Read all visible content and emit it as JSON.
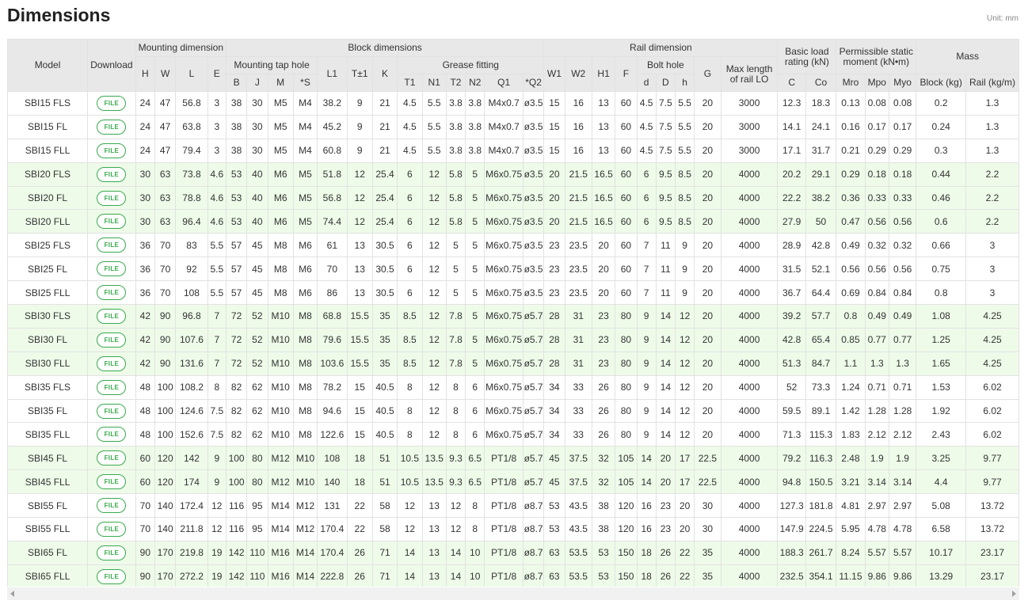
{
  "title": "Dimensions",
  "unit_note": "Unit: mm",
  "headers": {
    "model": "Model",
    "download": "Download",
    "mounting_dimension": "Mounting dimension",
    "block_dimensions": "Block dimensions",
    "rail_dimension": "Rail dimension",
    "basic_load_rating": "Basic load rating (kN)",
    "permissible_static_moment": "Permissible static moment (kN•m)",
    "mass": "Mass",
    "mounting_tap_hole": "Mounting tap hole",
    "grease_fitting": "Grease fitting",
    "bolt_hole": "Bolt hole",
    "max_length": "Max length of rail LO",
    "cols": {
      "H": "H",
      "W": "W",
      "L": "L",
      "E": "E",
      "B": "B",
      "J": "J",
      "M": "M",
      "S": "*S",
      "L1": "L1",
      "T": "T±1",
      "K": "K",
      "T1": "T1",
      "N1": "N1",
      "T2": "T2",
      "N2": "N2",
      "Q1": "Q1",
      "Q2": "*Q2",
      "W1": "W1",
      "W2": "W2",
      "H1": "H1",
      "F": "F",
      "d": "d",
      "D": "D",
      "h": "h",
      "G": "G",
      "C": "C",
      "Co": "Co",
      "Mro": "Mro",
      "Mpo": "Mpo",
      "Myo": "Myo",
      "block": "Block (kg)",
      "rail": "Rail (kg/m)"
    }
  },
  "file_label": "FILE",
  "rows": [
    [
      "SBI15 FLS",
      "24",
      "47",
      "56.8",
      "3",
      "38",
      "30",
      "M5",
      "M4",
      "38.2",
      "9",
      "21",
      "4.5",
      "5.5",
      "3.8",
      "3.8",
      "M4x0.7",
      "ø3.5",
      "15",
      "16",
      "13",
      "60",
      "4.5",
      "7.5",
      "5.5",
      "20",
      "3000",
      "12.3",
      "18.3",
      "0.13",
      "0.08",
      "0.08",
      "0.2",
      "1.3"
    ],
    [
      "SBI15 FL",
      "24",
      "47",
      "63.8",
      "3",
      "38",
      "30",
      "M5",
      "M4",
      "45.2",
      "9",
      "21",
      "4.5",
      "5.5",
      "3.8",
      "3.8",
      "M4x0.7",
      "ø3.5",
      "15",
      "16",
      "13",
      "60",
      "4.5",
      "7.5",
      "5.5",
      "20",
      "3000",
      "14.1",
      "24.1",
      "0.16",
      "0.17",
      "0.17",
      "0.24",
      "1.3"
    ],
    [
      "SBI15 FLL",
      "24",
      "47",
      "79.4",
      "3",
      "38",
      "30",
      "M5",
      "M4",
      "60.8",
      "9",
      "21",
      "4.5",
      "5.5",
      "3.8",
      "3.8",
      "M4x0.7",
      "ø3.5",
      "15",
      "16",
      "13",
      "60",
      "4.5",
      "7.5",
      "5.5",
      "20",
      "3000",
      "17.1",
      "31.7",
      "0.21",
      "0.29",
      "0.29",
      "0.3",
      "1.3"
    ],
    [
      "SBI20 FLS",
      "30",
      "63",
      "73.8",
      "4.6",
      "53",
      "40",
      "M6",
      "M5",
      "51.8",
      "12",
      "25.4",
      "6",
      "12",
      "5.8",
      "5",
      "M6x0.75",
      "ø3.5",
      "20",
      "21.5",
      "16.5",
      "60",
      "6",
      "9.5",
      "8.5",
      "20",
      "4000",
      "20.2",
      "29.1",
      "0.29",
      "0.18",
      "0.18",
      "0.44",
      "2.2"
    ],
    [
      "SBI20 FL",
      "30",
      "63",
      "78.8",
      "4.6",
      "53",
      "40",
      "M6",
      "M5",
      "56.8",
      "12",
      "25.4",
      "6",
      "12",
      "5.8",
      "5",
      "M6x0.75",
      "ø3.5",
      "20",
      "21.5",
      "16.5",
      "60",
      "6",
      "9.5",
      "8.5",
      "20",
      "4000",
      "22.2",
      "38.2",
      "0.36",
      "0.33",
      "0.33",
      "0.46",
      "2.2"
    ],
    [
      "SBI20 FLL",
      "30",
      "63",
      "96.4",
      "4.6",
      "53",
      "40",
      "M6",
      "M5",
      "74.4",
      "12",
      "25.4",
      "6",
      "12",
      "5.8",
      "5",
      "M6x0.75",
      "ø3.5",
      "20",
      "21.5",
      "16.5",
      "60",
      "6",
      "9.5",
      "8.5",
      "20",
      "4000",
      "27.9",
      "50",
      "0.47",
      "0.56",
      "0.56",
      "0.6",
      "2.2"
    ],
    [
      "SBI25 FLS",
      "36",
      "70",
      "83",
      "5.5",
      "57",
      "45",
      "M8",
      "M6",
      "61",
      "13",
      "30.5",
      "6",
      "12",
      "5",
      "5",
      "M6x0.75",
      "ø3.5",
      "23",
      "23.5",
      "20",
      "60",
      "7",
      "11",
      "9",
      "20",
      "4000",
      "28.9",
      "42.8",
      "0.49",
      "0.32",
      "0.32",
      "0.66",
      "3"
    ],
    [
      "SBI25 FL",
      "36",
      "70",
      "92",
      "5.5",
      "57",
      "45",
      "M8",
      "M6",
      "70",
      "13",
      "30.5",
      "6",
      "12",
      "5",
      "5",
      "M6x0.75",
      "ø3.5",
      "23",
      "23.5",
      "20",
      "60",
      "7",
      "11",
      "9",
      "20",
      "4000",
      "31.5",
      "52.1",
      "0.56",
      "0.56",
      "0.56",
      "0.75",
      "3"
    ],
    [
      "SBI25 FLL",
      "36",
      "70",
      "108",
      "5.5",
      "57",
      "45",
      "M8",
      "M6",
      "86",
      "13",
      "30.5",
      "6",
      "12",
      "5",
      "5",
      "M6x0.75",
      "ø3.5",
      "23",
      "23.5",
      "20",
      "60",
      "7",
      "11",
      "9",
      "20",
      "4000",
      "36.7",
      "64.4",
      "0.69",
      "0.84",
      "0.84",
      "0.8",
      "3"
    ],
    [
      "SBI30 FLS",
      "42",
      "90",
      "96.8",
      "7",
      "72",
      "52",
      "M10",
      "M8",
      "68.8",
      "15.5",
      "35",
      "8.5",
      "12",
      "7.8",
      "5",
      "M6x0.75",
      "ø5.7",
      "28",
      "31",
      "23",
      "80",
      "9",
      "14",
      "12",
      "20",
      "4000",
      "39.2",
      "57.7",
      "0.8",
      "0.49",
      "0.49",
      "1.08",
      "4.25"
    ],
    [
      "SBI30 FL",
      "42",
      "90",
      "107.6",
      "7",
      "72",
      "52",
      "M10",
      "M8",
      "79.6",
      "15.5",
      "35",
      "8.5",
      "12",
      "7.8",
      "5",
      "M6x0.75",
      "ø5.7",
      "28",
      "31",
      "23",
      "80",
      "9",
      "14",
      "12",
      "20",
      "4000",
      "42.8",
      "65.4",
      "0.85",
      "0.77",
      "0.77",
      "1.25",
      "4.25"
    ],
    [
      "SBI30 FLL",
      "42",
      "90",
      "131.6",
      "7",
      "72",
      "52",
      "M10",
      "M8",
      "103.6",
      "15.5",
      "35",
      "8.5",
      "12",
      "7.8",
      "5",
      "M6x0.75",
      "ø5.7",
      "28",
      "31",
      "23",
      "80",
      "9",
      "14",
      "12",
      "20",
      "4000",
      "51.3",
      "84.7",
      "1.1",
      "1.3",
      "1.3",
      "1.65",
      "4.25"
    ],
    [
      "SBI35 FLS",
      "48",
      "100",
      "108.2",
      "8",
      "82",
      "62",
      "M10",
      "M8",
      "78.2",
      "15",
      "40.5",
      "8",
      "12",
      "8",
      "6",
      "M6x0.75",
      "ø5.7",
      "34",
      "33",
      "26",
      "80",
      "9",
      "14",
      "12",
      "20",
      "4000",
      "52",
      "73.3",
      "1.24",
      "0.71",
      "0.71",
      "1.53",
      "6.02"
    ],
    [
      "SBI35 FL",
      "48",
      "100",
      "124.6",
      "7.5",
      "82",
      "62",
      "M10",
      "M8",
      "94.6",
      "15",
      "40.5",
      "8",
      "12",
      "8",
      "6",
      "M6x0.75",
      "ø5.7",
      "34",
      "33",
      "26",
      "80",
      "9",
      "14",
      "12",
      "20",
      "4000",
      "59.5",
      "89.1",
      "1.42",
      "1.28",
      "1.28",
      "1.92",
      "6.02"
    ],
    [
      "SBI35 FLL",
      "48",
      "100",
      "152.6",
      "7.5",
      "82",
      "62",
      "M10",
      "M8",
      "122.6",
      "15",
      "40.5",
      "8",
      "12",
      "8",
      "6",
      "M6x0.75",
      "ø5.7",
      "34",
      "33",
      "26",
      "80",
      "9",
      "14",
      "12",
      "20",
      "4000",
      "71.3",
      "115.3",
      "1.83",
      "2.12",
      "2.12",
      "2.43",
      "6.02"
    ],
    [
      "SBI45 FL",
      "60",
      "120",
      "142",
      "9",
      "100",
      "80",
      "M12",
      "M10",
      "108",
      "18",
      "51",
      "10.5",
      "13.5",
      "9.3",
      "6.5",
      "PT1/8",
      "ø5.7",
      "45",
      "37.5",
      "32",
      "105",
      "14",
      "20",
      "17",
      "22.5",
      "4000",
      "79.2",
      "116.3",
      "2.48",
      "1.9",
      "1.9",
      "3.25",
      "9.77"
    ],
    [
      "SBI45 FLL",
      "60",
      "120",
      "174",
      "9",
      "100",
      "80",
      "M12",
      "M10",
      "140",
      "18",
      "51",
      "10.5",
      "13.5",
      "9.3",
      "6.5",
      "PT1/8",
      "ø5.7",
      "45",
      "37.5",
      "32",
      "105",
      "14",
      "20",
      "17",
      "22.5",
      "4000",
      "94.8",
      "150.5",
      "3.21",
      "3.14",
      "3.14",
      "4.4",
      "9.77"
    ],
    [
      "SBI55 FL",
      "70",
      "140",
      "172.4",
      "12",
      "116",
      "95",
      "M14",
      "M12",
      "131",
      "22",
      "58",
      "12",
      "13",
      "12",
      "8",
      "PT1/8",
      "ø8.7",
      "53",
      "43.5",
      "38",
      "120",
      "16",
      "23",
      "20",
      "30",
      "4000",
      "127.3",
      "181.8",
      "4.81",
      "2.97",
      "2.97",
      "5.08",
      "13.72"
    ],
    [
      "SBI55 FLL",
      "70",
      "140",
      "211.8",
      "12",
      "116",
      "95",
      "M14",
      "M12",
      "170.4",
      "22",
      "58",
      "12",
      "13",
      "12",
      "8",
      "PT1/8",
      "ø8.7",
      "53",
      "43.5",
      "38",
      "120",
      "16",
      "23",
      "20",
      "30",
      "4000",
      "147.9",
      "224.5",
      "5.95",
      "4.78",
      "4.78",
      "6.58",
      "13.72"
    ],
    [
      "SBI65 FL",
      "90",
      "170",
      "219.8",
      "19",
      "142",
      "110",
      "M16",
      "M14",
      "170.4",
      "26",
      "71",
      "14",
      "13",
      "14",
      "10",
      "PT1/8",
      "ø8.7",
      "63",
      "53.5",
      "53",
      "150",
      "18",
      "26",
      "22",
      "35",
      "4000",
      "188.3",
      "261.7",
      "8.24",
      "5.57",
      "5.57",
      "10.17",
      "23.17"
    ],
    [
      "SBI65 FLL",
      "90",
      "170",
      "272.2",
      "19",
      "142",
      "110",
      "M16",
      "M14",
      "222.8",
      "26",
      "71",
      "14",
      "13",
      "14",
      "10",
      "PT1/8",
      "ø8.7",
      "63",
      "53.5",
      "53",
      "150",
      "18",
      "26",
      "22",
      "35",
      "4000",
      "232.5",
      "354.1",
      "11.15",
      "9.86",
      "9.86",
      "13.29",
      "23.17"
    ]
  ],
  "row_groups": [
    "white",
    "white",
    "white",
    "green",
    "green",
    "green",
    "white",
    "white",
    "white",
    "green",
    "green",
    "green",
    "white",
    "white",
    "white",
    "green",
    "green",
    "white",
    "white",
    "green",
    "green"
  ],
  "row_colors": {
    "white": "#ffffff",
    "green": "#eefbe9"
  },
  "accent_color": "#39a94e"
}
